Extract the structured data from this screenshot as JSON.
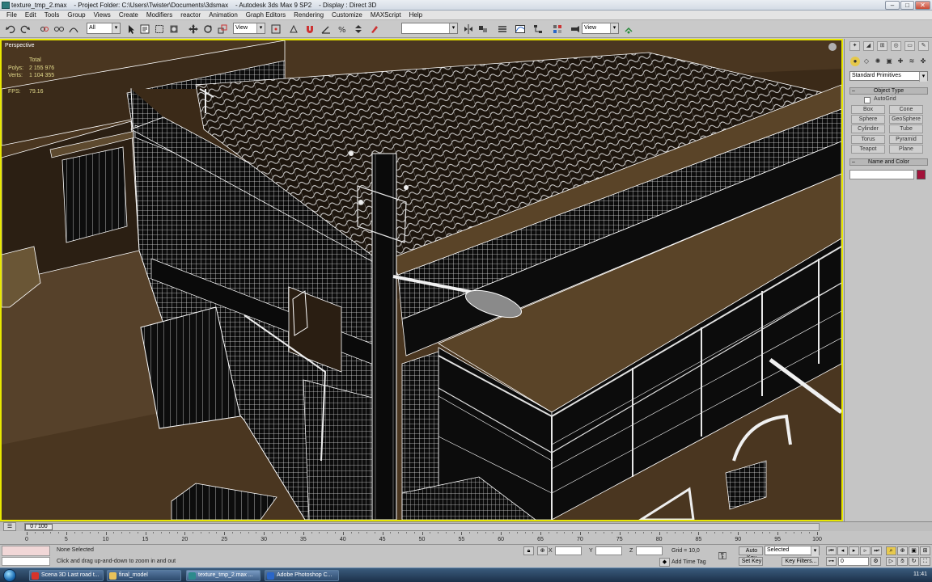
{
  "window": {
    "title": "texture_tmp_2.max    - Project Folder: C:\\Users\\Twister\\Documents\\3dsmax    - Autodesk 3ds Max 9 SP2    - Display : Direct 3D",
    "minimize": "–",
    "maximize": "□",
    "close": "✕"
  },
  "menu": [
    "File",
    "Edit",
    "Tools",
    "Group",
    "Views",
    "Create",
    "Modifiers",
    "reactor",
    "Animation",
    "Graph Editors",
    "Rendering",
    "Customize",
    "MAXScript",
    "Help"
  ],
  "toolbar": {
    "selection_filter": "All",
    "ref_coord": "View",
    "named_selection": "",
    "view_dropdown": "View"
  },
  "viewport": {
    "label": "Perspective",
    "stats": {
      "total_label": "Total",
      "polys_label": "Polys:",
      "polys_value": "2 155 976",
      "verts_label": "Verts:",
      "verts_value": "1 104 355",
      "fps_label": "FPS:",
      "fps_value": "79.16"
    }
  },
  "command_panel": {
    "category_dropdown": "Standard Primitives",
    "object_type_header": "Object Type",
    "autogrid_label": "AutoGrid",
    "primitives": [
      "Box",
      "Cone",
      "Sphere",
      "GeoSphere",
      "Cylinder",
      "Tube",
      "Torus",
      "Pyramid",
      "Teapot",
      "Plane"
    ],
    "name_color_header": "Name and Color",
    "object_name": "",
    "color": "#a3123a"
  },
  "timeline": {
    "slider_label": "0 / 100",
    "ticks": [
      "0",
      "5",
      "10",
      "15",
      "20",
      "25",
      "30",
      "35",
      "40",
      "45",
      "50",
      "55",
      "60",
      "65",
      "70",
      "75",
      "80",
      "85",
      "90",
      "95",
      "100"
    ]
  },
  "status": {
    "selection_text": "None Selected",
    "prompt_text": "Click and drag up-and-down to zoom in and out",
    "x_label": "X",
    "y_label": "Y",
    "z_label": "Z",
    "x_value": "",
    "y_value": "",
    "z_value": "",
    "grid_label": "Grid = 10,0",
    "add_time_tag": "Add Time Tag",
    "auto_key": "Auto Key",
    "set_key": "Set Key",
    "selected_dropdown": "Selected",
    "key_filters": "Key Filters...",
    "frame_value": "0"
  },
  "taskbar": {
    "tasks": [
      {
        "label": "Scena 3D Last road t...",
        "color": "#d8342b"
      },
      {
        "label": "final_model",
        "color": "#e8c15a"
      },
      {
        "label": "texture_tmp_2.max ...",
        "color": "#2c8a8c"
      },
      {
        "label": "Adobe Photoshop C...",
        "color": "#2a66c8"
      }
    ],
    "clock": "11:41"
  }
}
